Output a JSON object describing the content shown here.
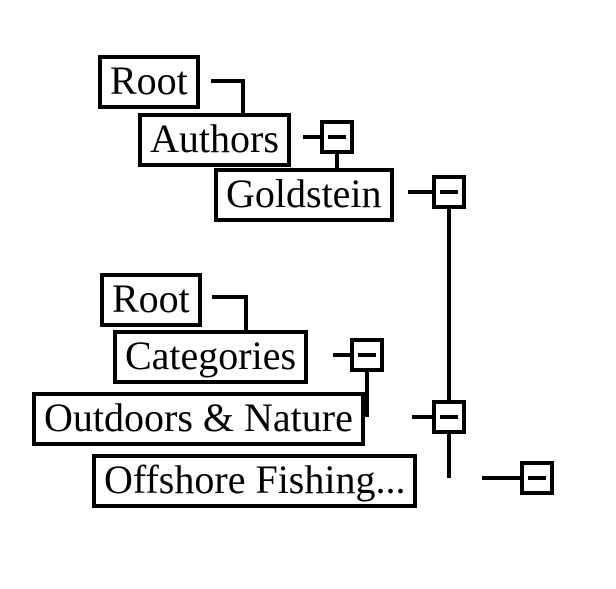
{
  "tree1": {
    "root": {
      "label": "Root"
    },
    "authors": {
      "label": "Authors",
      "toggle": "-"
    },
    "goldstein": {
      "label": "Goldstein",
      "toggle": "-"
    }
  },
  "tree2": {
    "root": {
      "label": "Root"
    },
    "categories": {
      "label": "Categories",
      "toggle": "-"
    },
    "outdoors": {
      "label": "Outdoors & Nature",
      "toggle": "-"
    },
    "offshore": {
      "label": "Offshore Fishing...",
      "toggle": "-"
    }
  }
}
